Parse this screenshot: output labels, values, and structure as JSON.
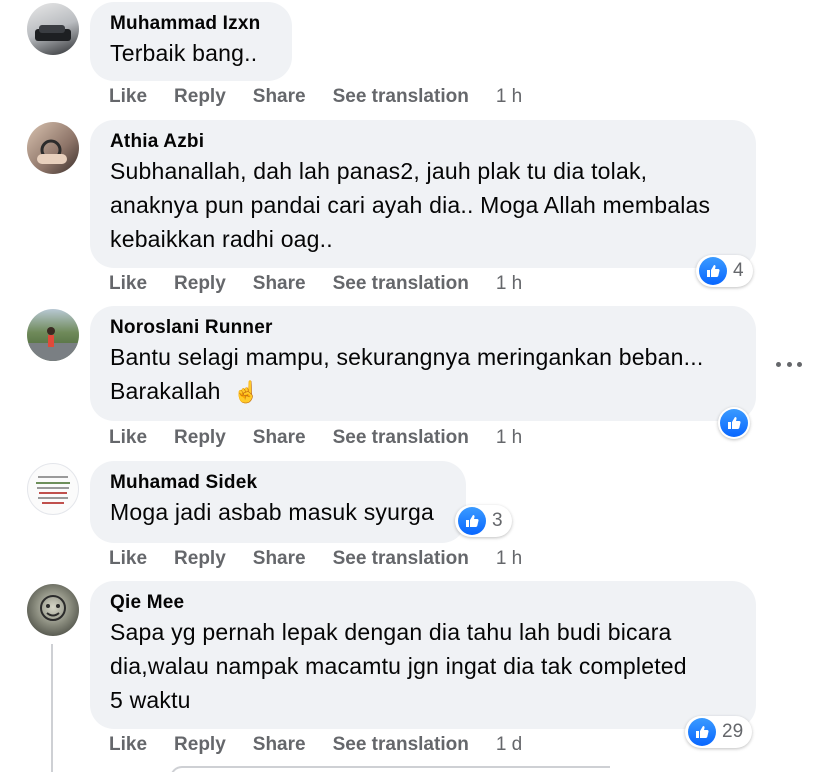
{
  "actions": {
    "like": "Like",
    "reply": "Reply",
    "share": "Share",
    "translate": "See translation"
  },
  "comments": [
    {
      "author": "Muhammad Izxn",
      "lines": [
        "Terbaik bang.."
      ],
      "time": "1 h",
      "reactions": null
    },
    {
      "author": "Athia Azbi",
      "lines": [
        "Subhanallah, dah lah panas2, jauh plak tu dia tolak,",
        "anaknya pun pandai cari ayah dia.. Moga Allah membalas",
        "kebaikkan radhi oag.."
      ],
      "time": "1 h",
      "reactions": "4"
    },
    {
      "author": "Noroslani Runner",
      "lines": [
        "Bantu selagi mampu, sekurangnya meringankan beban...",
        "Barakallah"
      ],
      "emoji": "☝️",
      "time": "1 h",
      "reactions": ""
    },
    {
      "author": "Muhamad Sidek",
      "lines": [
        "Moga jadi asbab masuk syurga"
      ],
      "time": "1 h",
      "reactions": "3"
    },
    {
      "author": "Qie Mee",
      "lines": [
        "Sapa yg pernah lepak dengan dia tahu lah budi bicara",
        "dia,walau nampak macamtu jgn ingat dia tak completed",
        "5 waktu"
      ],
      "time": "1 d",
      "reactions": "29"
    }
  ],
  "colors": {
    "bubble": "#f0f2f5",
    "action_text": "#65676b",
    "like_blue": "#0866ff"
  },
  "icons": {
    "more": "more-horizontal-icon",
    "like": "thumbs-up-icon"
  }
}
